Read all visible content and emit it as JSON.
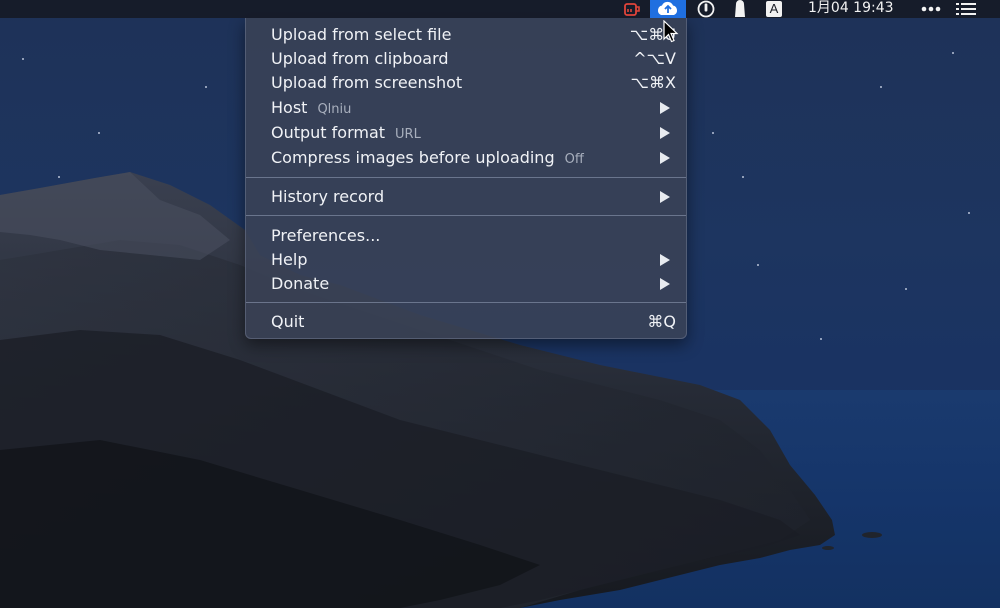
{
  "menubar": {
    "icons": [
      {
        "name": "tea-cup-icon",
        "color": "#e0443a"
      },
      {
        "name": "picgo-cloud-icon",
        "active": true,
        "color": "#1f6fe0"
      },
      {
        "name": "power-circle-icon"
      },
      {
        "name": "ghost-icon"
      },
      {
        "name": "input-method-icon",
        "label": "A"
      },
      {
        "name": "more-dots-icon"
      },
      {
        "name": "list-menu-icon"
      }
    ],
    "clock": "1月04 19:43"
  },
  "menu": {
    "items": [
      {
        "label": "Upload from select file",
        "shortcut": "⌥⌘U"
      },
      {
        "label": "Upload from clipboard",
        "shortcut": "^⌥V"
      },
      {
        "label": "Upload from screenshot",
        "shortcut": "⌥⌘X"
      },
      {
        "label": "Host",
        "value": "Qlniu",
        "submenu": true
      },
      {
        "label": "Output format",
        "value": "URL",
        "submenu": true
      },
      {
        "label": "Compress images before uploading",
        "value": "Off",
        "submenu": true
      },
      {
        "label": "History record",
        "submenu": true
      },
      {
        "label": "Preferences..."
      },
      {
        "label": "Help",
        "submenu": true
      },
      {
        "label": "Donate",
        "submenu": true
      },
      {
        "label": "Quit",
        "shortcut": "⌘Q"
      }
    ]
  }
}
